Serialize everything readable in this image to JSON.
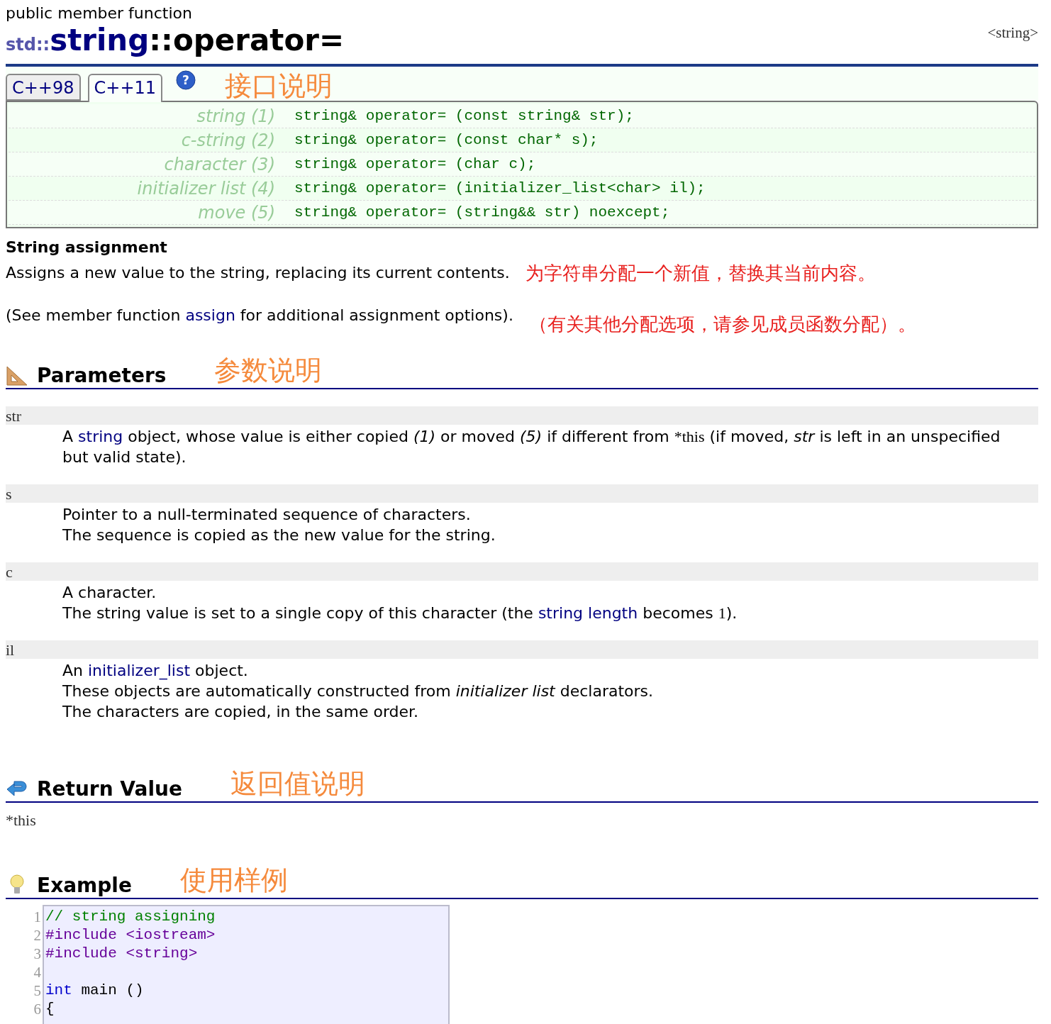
{
  "header": {
    "kind_label": "public member function",
    "namespace": "std::",
    "class_name": "string",
    "member": "::operator=",
    "header_file": "<string>"
  },
  "tabs": [
    {
      "label": "C++98",
      "selected": false
    },
    {
      "label": "C++11",
      "selected": true
    }
  ],
  "help_label": "?",
  "tabs_note": "接口说明",
  "prototypes": [
    {
      "label": "string (1)",
      "code": "string& operator= (const string& str);"
    },
    {
      "label": "c-string (2)",
      "code": "string& operator= (const char* s);"
    },
    {
      "label": "character (3)",
      "code": "string& operator= (char c);"
    },
    {
      "label": "initializer list (4)",
      "code": "string& operator= (initializer_list<char> il);"
    },
    {
      "label": "move (5)",
      "code": "string& operator= (string&& str) noexcept;"
    }
  ],
  "description": {
    "title": "String assignment",
    "paragraphs": [
      {
        "segments": [
          {
            "kind": "text",
            "text": "Assigns a new value to the string, replacing its current contents."
          }
        ],
        "translation": "为字符串分配一个新值，替换其当前内容。"
      },
      {
        "segments": [
          {
            "kind": "text",
            "text": "(See member function "
          },
          {
            "kind": "link",
            "text": "assign"
          },
          {
            "kind": "text",
            "text": " for additional assignment options)."
          }
        ],
        "translation": "（有关其他分配选项，请参见成员函数分配）。"
      }
    ]
  },
  "parameters": {
    "title": "Parameters",
    "note": "参数说明",
    "items": [
      {
        "name": "str",
        "lines": [
          [
            {
              "kind": "text",
              "text": "A "
            },
            {
              "kind": "link",
              "text": "string"
            },
            {
              "kind": "text",
              "text": " object, whose value is either copied "
            },
            {
              "kind": "em",
              "text": "(1)"
            },
            {
              "kind": "text",
              "text": " or moved "
            },
            {
              "kind": "em",
              "text": "(5)"
            },
            {
              "kind": "text",
              "text": " if different from "
            },
            {
              "kind": "code",
              "text": "*this"
            },
            {
              "kind": "text",
              "text": " (if moved, "
            },
            {
              "kind": "em",
              "text": "str"
            },
            {
              "kind": "text",
              "text": " is left in an unspecified but valid state)."
            }
          ]
        ]
      },
      {
        "name": "s",
        "lines": [
          [
            {
              "kind": "text",
              "text": "Pointer to a null-terminated sequence of characters."
            }
          ],
          [
            {
              "kind": "text",
              "text": "The sequence is copied as the new value for the string."
            }
          ]
        ]
      },
      {
        "name": "c",
        "lines": [
          [
            {
              "kind": "text",
              "text": "A character."
            }
          ],
          [
            {
              "kind": "text",
              "text": "The string value is set to a single copy of this character (the "
            },
            {
              "kind": "link",
              "text": "string length"
            },
            {
              "kind": "text",
              "text": " becomes "
            },
            {
              "kind": "code",
              "text": "1"
            },
            {
              "kind": "text",
              "text": ")."
            }
          ]
        ]
      },
      {
        "name": "il",
        "lines": [
          [
            {
              "kind": "text",
              "text": "An "
            },
            {
              "kind": "link",
              "text": "initializer_list"
            },
            {
              "kind": "text",
              "text": " object."
            }
          ],
          [
            {
              "kind": "text",
              "text": "These objects are automatically constructed from "
            },
            {
              "kind": "em",
              "text": "initializer list"
            },
            {
              "kind": "text",
              "text": " declarators."
            }
          ],
          [
            {
              "kind": "text",
              "text": "The characters are copied, in the same order."
            }
          ]
        ]
      }
    ]
  },
  "return_value": {
    "title": "Return Value",
    "note": "返回值说明",
    "value": "*this"
  },
  "example": {
    "title": "Example",
    "note": "使用样例",
    "lines": [
      {
        "number": "1",
        "tokens": [
          {
            "kind": "comment",
            "text": "// string assigning"
          }
        ]
      },
      {
        "number": "2",
        "tokens": [
          {
            "kind": "directive",
            "text": "#include <iostream>"
          }
        ]
      },
      {
        "number": "3",
        "tokens": [
          {
            "kind": "directive",
            "text": "#include <string>"
          }
        ]
      },
      {
        "number": "4"
      },
      {
        "number": "5",
        "tokens": [
          {
            "kind": "keyword",
            "text": "int"
          },
          {
            "kind": "plain",
            "text": " main ()"
          }
        ]
      },
      {
        "number": "6",
        "tokens": [
          {
            "kind": "plain",
            "text": "{"
          }
        ]
      }
    ]
  }
}
